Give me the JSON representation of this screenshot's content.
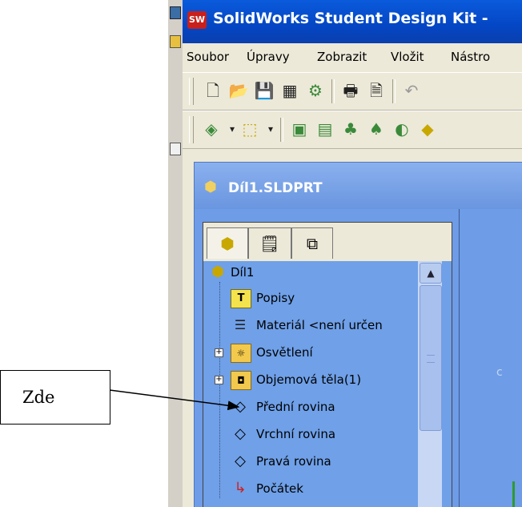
{
  "window": {
    "title": "SolidWorks Student Design Kit -",
    "logo_text": "SW"
  },
  "menu": [
    "Soubor",
    "Úpravy",
    "Zobrazit",
    "Vložit",
    "Nástro"
  ],
  "document": {
    "title": "Díl1.SLDPRT"
  },
  "tree": {
    "root": "Díl1",
    "items": [
      {
        "label": "Popisy",
        "icon": "annotations-icon"
      },
      {
        "label": "Materiál <není určen",
        "icon": "material-icon"
      },
      {
        "label": "Osvětlení",
        "icon": "lighting-icon",
        "expandable": true
      },
      {
        "label": "Objemová těla(1)",
        "icon": "solid-bodies-icon",
        "expandable": true
      },
      {
        "label": "Přední rovina",
        "icon": "plane-icon"
      },
      {
        "label": "Vrchní rovina",
        "icon": "plane-icon"
      },
      {
        "label": "Pravá rovina",
        "icon": "plane-icon"
      },
      {
        "label": "Počátek",
        "icon": "origin-icon"
      }
    ]
  },
  "callout": {
    "text": "Zde"
  },
  "colors": {
    "titlebar": "#0a5bdc",
    "tree_bg": "#6fa0e8",
    "doc_bg": "#7aa4e6"
  }
}
